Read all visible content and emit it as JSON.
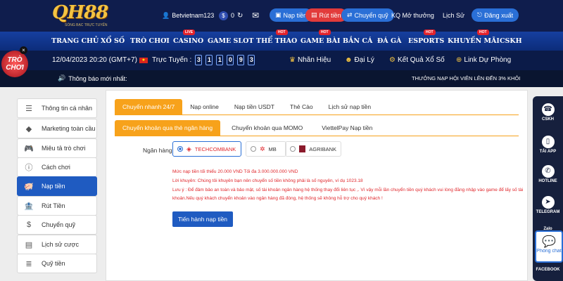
{
  "header": {
    "logo_text": "QH88",
    "logo_tagline": "SÒNG BẠC TRỰC TUYẾN",
    "username": "Betvietnam123",
    "balance": "0",
    "deposit_label": "Nạp tiền",
    "withdraw_label": "Rút tiền",
    "transfer_label": "Chuyển quỹ",
    "promo_label": "KQ Mở thưởng",
    "history_label": "Lịch Sử",
    "logout_label": "Đăng xuất"
  },
  "nav": {
    "items": [
      {
        "label": "TRANG CHỦ"
      },
      {
        "label": "XỔ SỐ"
      },
      {
        "label": "TRÒ CHƠI"
      },
      {
        "label": "CASINO",
        "badge": "LIVE"
      },
      {
        "label": "GAME SLOT"
      },
      {
        "label": "THỂ THAO",
        "badge": "HOT"
      },
      {
        "label": "GAME BÀI",
        "badge": "HOT"
      },
      {
        "label": "BẮN CÁ"
      },
      {
        "label": "ĐÁ GÀ"
      },
      {
        "label": "ESPORTS",
        "badge": "HOT"
      },
      {
        "label": "KHUYẾN MÃI",
        "badge": "HOT"
      },
      {
        "label": "CSKH"
      }
    ]
  },
  "info": {
    "datetime": "12/04/2023 20:20 (GMT+7)",
    "online_label": "Trực Tuyến :",
    "online_digits": [
      "3",
      "1",
      "1",
      "0",
      "9",
      "3"
    ],
    "nhan_hieu": "Nhãn Hiệu",
    "dai_ly": "Đại Lý",
    "ket_qua": "Kết Quả Xổ Số",
    "link_du_phong": "Link Dự Phòng"
  },
  "notice": {
    "label": "Thông báo mới nhất:",
    "ticker": "THƯỞNG NẠP HỘI VIÊN LÊN ĐẾN 3% KHỎI"
  },
  "promo_bubble": {
    "text": "TRÒ CHƠI",
    "close": "×"
  },
  "sidebar": {
    "items": [
      {
        "label": "Thông tin cá nhân"
      },
      {
        "label": "Marketing toàn cầu"
      },
      {
        "label": "Miêu tả trò chơi"
      },
      {
        "label": "Cách chơi"
      },
      {
        "label": "Nạp tiền"
      },
      {
        "label": "Rút Tiền"
      },
      {
        "label": "Chuyển quỹ"
      },
      {
        "label": "Lịch sử cược"
      },
      {
        "label": "Quỹ tiền"
      }
    ]
  },
  "tabs": {
    "main": [
      "Chuyển nhanh 24/7",
      "Nạp online",
      "Nạp tiền USDT",
      "Thẻ Cào",
      "Lịch sử nạp tiền"
    ],
    "sub": [
      "Chuyển khoản qua thẻ ngân hàng",
      "Chuyển khoản qua MOMO",
      "ViettelPay Nạp tiền"
    ]
  },
  "form": {
    "bank_label": "Ngân hàng",
    "banks": [
      "TECHCOMBANK",
      "MB",
      "AGRIBANK"
    ],
    "msg_limit": "Mức nạp tiền tối thiểu 20.000 VND Tối đa 3.000.000.000 VND",
    "msg_advice": "Lời khuyên: Chúng tôi khuyên bạn nên chuyển số tiền không phải là số nguyên, ví dụ 1023.18",
    "msg_note1": "Lưu ý : Để đảm bảo an toàn và bảo mật, số tài khoản ngân hàng hệ thống thay đổi liên tục ,. Vì vậy mỗi lần chuyển tiền quý khách vui lòng đăng nhập vào game để lấy số tài",
    "msg_note2": "khoản.Nếu quý khách chuyển khoản vào ngân hàng đã đóng, hệ thống sẽ không hỗ trợ cho quý khách !",
    "submit_label": "Tiến hành nạp tiền"
  },
  "rail": {
    "items": [
      "CSKH",
      "TẢI APP",
      "HOTLINE",
      "TELEGRAM",
      "Zalo",
      "FACEBOOK"
    ],
    "chat_label": "Phòng chat"
  },
  "colors": {
    "brand": "#0f1d4d",
    "accent": "#f7a21b",
    "primary": "#1f5bc1",
    "danger": "#e0262b"
  }
}
